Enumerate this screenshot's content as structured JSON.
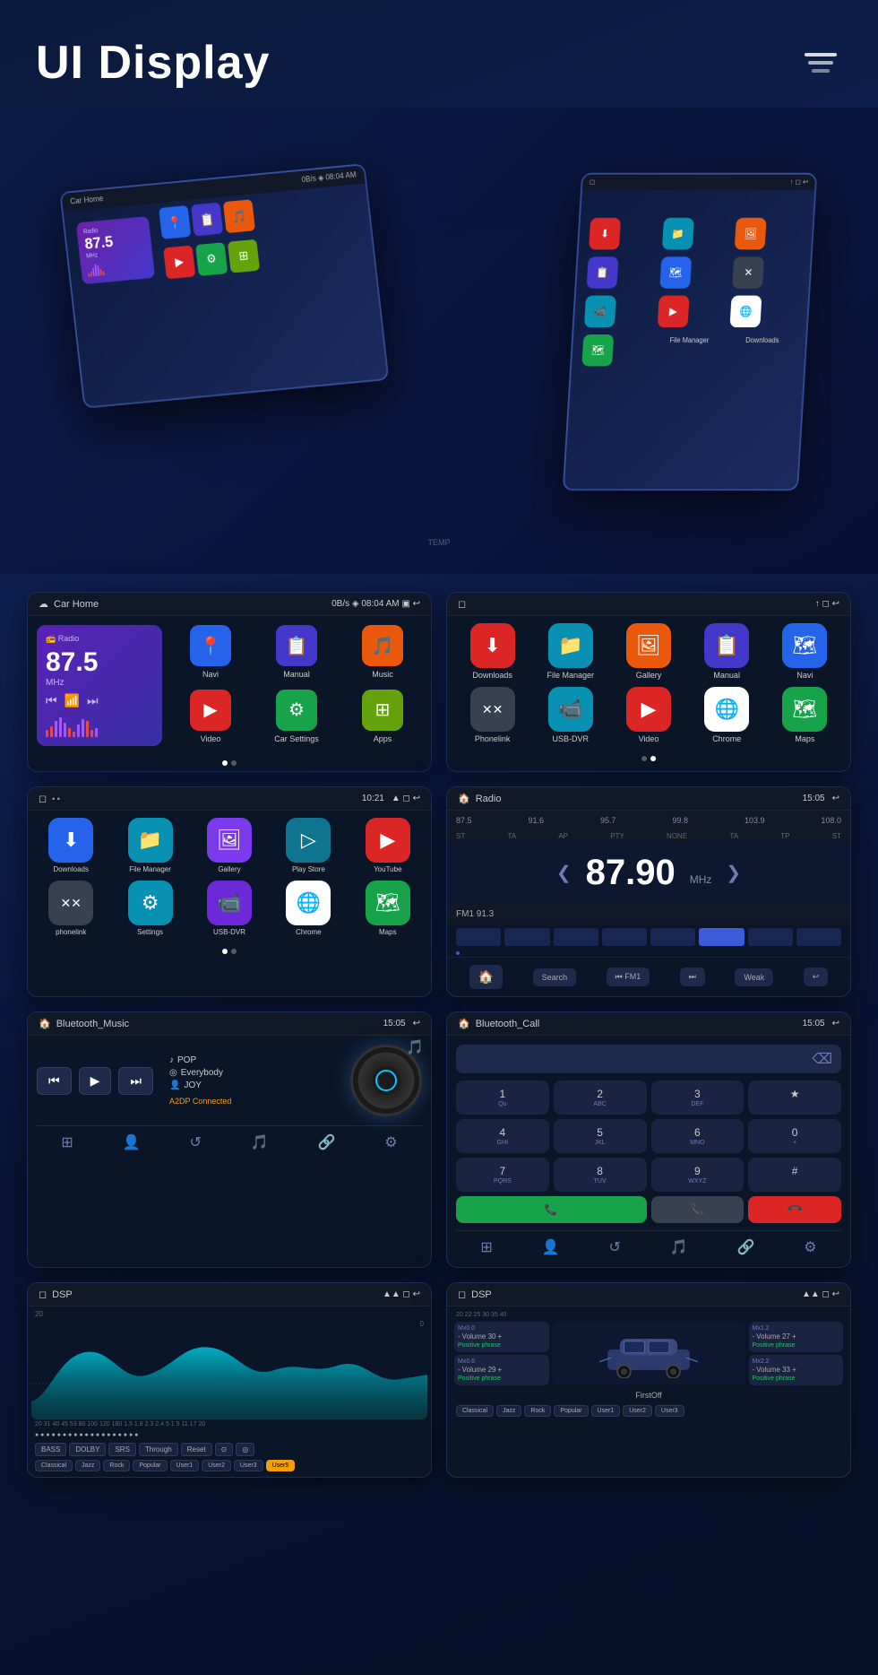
{
  "header": {
    "title": "UI Display",
    "layers_label": "layers"
  },
  "card1": {
    "title": "Car Home",
    "status": "0B/s ◈ 08:04 AM ▣ ↩",
    "time": "08:04 AM",
    "radio": {
      "label": "Radio",
      "freq": "87.5",
      "unit": "MHz"
    },
    "apps": [
      {
        "label": "Navi",
        "color": "bg-blue",
        "icon": "📍"
      },
      {
        "label": "Manual",
        "color": "bg-indigo",
        "icon": "📋"
      },
      {
        "label": "Music",
        "color": "bg-orange",
        "icon": "🎵"
      },
      {
        "label": "Video",
        "color": "bg-red",
        "icon": "▶"
      },
      {
        "label": "Car Settings",
        "color": "bg-green",
        "icon": "⚙"
      },
      {
        "label": "Apps",
        "color": "bg-lime",
        "icon": "⊞"
      }
    ]
  },
  "card2": {
    "title": "",
    "time": "",
    "apps_row1": [
      {
        "label": "Downloads",
        "color": "bg-red",
        "icon": "⬇"
      },
      {
        "label": "File Manager",
        "color": "bg-teal",
        "icon": "📁"
      },
      {
        "label": "Gallery",
        "color": "bg-orange",
        "icon": "🖼"
      },
      {
        "label": "Manual",
        "color": "bg-indigo",
        "icon": "📋"
      },
      {
        "label": "Navi",
        "color": "bg-blue",
        "icon": "🗺"
      }
    ],
    "apps_row2": [
      {
        "label": "Phonelink",
        "color": "bg-gray",
        "icon": "✕✕"
      },
      {
        "label": "USB-DVR",
        "color": "bg-teal",
        "icon": "📹"
      },
      {
        "label": "Video",
        "color": "bg-red",
        "icon": "▶"
      },
      {
        "label": "Chrome",
        "color": "bg-white",
        "icon": "🌐"
      },
      {
        "label": "Maps",
        "color": "bg-green",
        "icon": "🗺"
      }
    ]
  },
  "card3": {
    "header_left": "🏠",
    "time": "10:21",
    "apps": [
      {
        "label": "Downloads",
        "color": "bg-blue",
        "icon": "⬇"
      },
      {
        "label": "File Manager",
        "color": "bg-teal",
        "icon": "📁"
      },
      {
        "label": "Gallery",
        "color": "bg-purple",
        "icon": "🖼"
      },
      {
        "label": "Play Store",
        "color": "bg-cyan",
        "icon": "▷"
      },
      {
        "label": "YouTube",
        "color": "bg-red",
        "icon": "▶"
      },
      {
        "label": "phonelink",
        "color": "bg-gray",
        "icon": "✕✕"
      },
      {
        "label": "Settings",
        "color": "bg-teal",
        "icon": "⚙"
      },
      {
        "label": "USB-DVR",
        "color": "bg-violet",
        "icon": "📹"
      },
      {
        "label": "Chrome",
        "color": "bg-white",
        "icon": "🌐"
      },
      {
        "label": "Maps",
        "color": "bg-green",
        "icon": "🗺"
      }
    ]
  },
  "card4": {
    "title": "Radio",
    "time": "15:05",
    "freq_marks": [
      "87.5",
      "91.6",
      "95.7",
      "99.8",
      "103.9",
      "108.0"
    ],
    "band_labels": [
      "ST",
      "TA",
      "AP",
      "PTY",
      "NONE",
      "TA",
      "TP",
      "ST"
    ],
    "current_freq": "87.90",
    "unit": "MHz",
    "preset": "FM1 91.3",
    "buttons": [
      "Search",
      "⏮ FM1",
      "⏭",
      "Weak",
      "↩"
    ]
  },
  "card5": {
    "title": "Bluetooth_Music",
    "time": "15:05",
    "genre": "POP",
    "track": "Everybody",
    "artist": "JOY",
    "status": "A2DP Connected"
  },
  "card6": {
    "title": "Bluetooth_Call",
    "time": "15:05",
    "dialpad": [
      {
        "key": "1",
        "sub": "Qu"
      },
      {
        "key": "2",
        "sub": "ABC"
      },
      {
        "key": "3",
        "sub": "DEF"
      },
      {
        "key": "*",
        "sub": ""
      },
      {
        "key": "4",
        "sub": "GHI"
      },
      {
        "key": "5",
        "sub": "JKL"
      },
      {
        "key": "6",
        "sub": "MNO"
      },
      {
        "key": "0",
        "sub": "+"
      },
      {
        "key": "7",
        "sub": "PQRS"
      },
      {
        "key": "8",
        "sub": "TUV"
      },
      {
        "key": "9",
        "sub": "WXYZ"
      },
      {
        "key": "#",
        "sub": ""
      },
      {
        "key": "📞",
        "sub": "call",
        "type": "call"
      },
      {
        "key": "📞",
        "sub": "end",
        "type": "end"
      }
    ]
  },
  "card7": {
    "title": "DSP",
    "time": "",
    "eq_labels": [
      "20",
      "31",
      "40",
      "45",
      "53",
      "80",
      "100",
      "120",
      "180",
      "1.5",
      "1.8",
      "2.3",
      "2.4",
      "5",
      "1",
      "5",
      "11",
      "17",
      "20"
    ],
    "modes": [
      "BASS",
      "DOLBY",
      "SRS",
      "Through",
      "Reset"
    ],
    "presets": [
      "Classical",
      "Jazz",
      "Rock",
      "Popular",
      "User1",
      "User2",
      "User3",
      "User5"
    ]
  },
  "card8": {
    "title": "DSP",
    "time": "",
    "eq_items": [
      {
        "label": "Mx0.0",
        "vol": "Volume 30",
        "phrase": "Positive phrase"
      },
      {
        "label": "Mx1.2",
        "vol": "Volume 27",
        "phrase": "Positive phrase"
      },
      {
        "label": "Mx0.6",
        "vol": "Volume 29",
        "phrase": "Positive phrase"
      },
      {
        "label": "Mx2.2",
        "vol": "Volume 33",
        "phrase": "Positive phrase"
      }
    ],
    "first_off": "FirstOff",
    "presets": [
      "Classical",
      "Jazz",
      "Rock",
      "Popular",
      "User1",
      "User2",
      "User3"
    ]
  }
}
